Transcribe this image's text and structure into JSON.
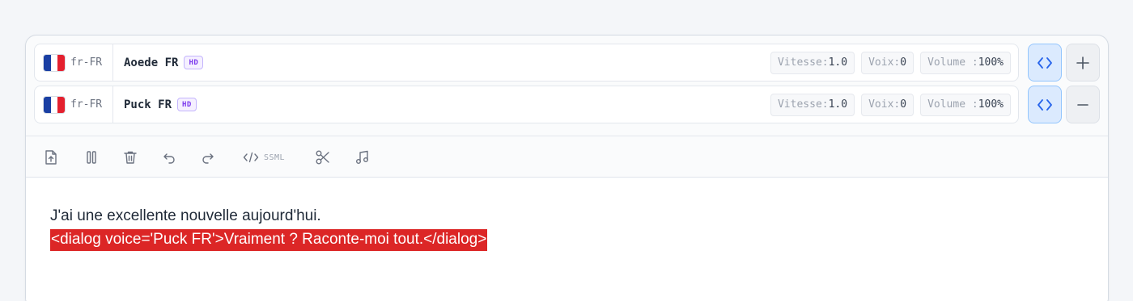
{
  "voices": [
    {
      "lang_code": "fr-FR",
      "name": "Aoede FR",
      "badge": "HD",
      "speed_label": "Vitesse:",
      "speed": "1.0",
      "voice_label": "Voix:",
      "voice": "0",
      "volume_label": "Volume :",
      "volume": "100%",
      "action_icon": "plus-icon",
      "action_glyph": "+"
    },
    {
      "lang_code": "fr-FR",
      "name": "Puck FR",
      "badge": "HD",
      "speed_label": "Vitesse:",
      "speed": "1.0",
      "voice_label": "Voix:",
      "voice": "0",
      "volume_label": "Volume :",
      "volume": "100%",
      "action_icon": "minus-icon",
      "action_glyph": "−"
    }
  ],
  "toolbar": {
    "ssml_label": "SSML",
    "icons": [
      "upload-file-icon",
      "pause-icon",
      "trash-icon",
      "undo-icon",
      "redo-icon",
      "code-icon",
      "scissors-icon",
      "music-note-icon"
    ]
  },
  "editor": {
    "line1": "J'ai une excellente nouvelle aujourd'hui.",
    "line2": "<dialog voice='Puck FR'>Vraiment ? Raconte-moi tout.</dialog>"
  },
  "colors": {
    "accent_blue": "#dbeafe",
    "highlight_red": "#dc2626",
    "hd_badge": "#7c3aed"
  }
}
